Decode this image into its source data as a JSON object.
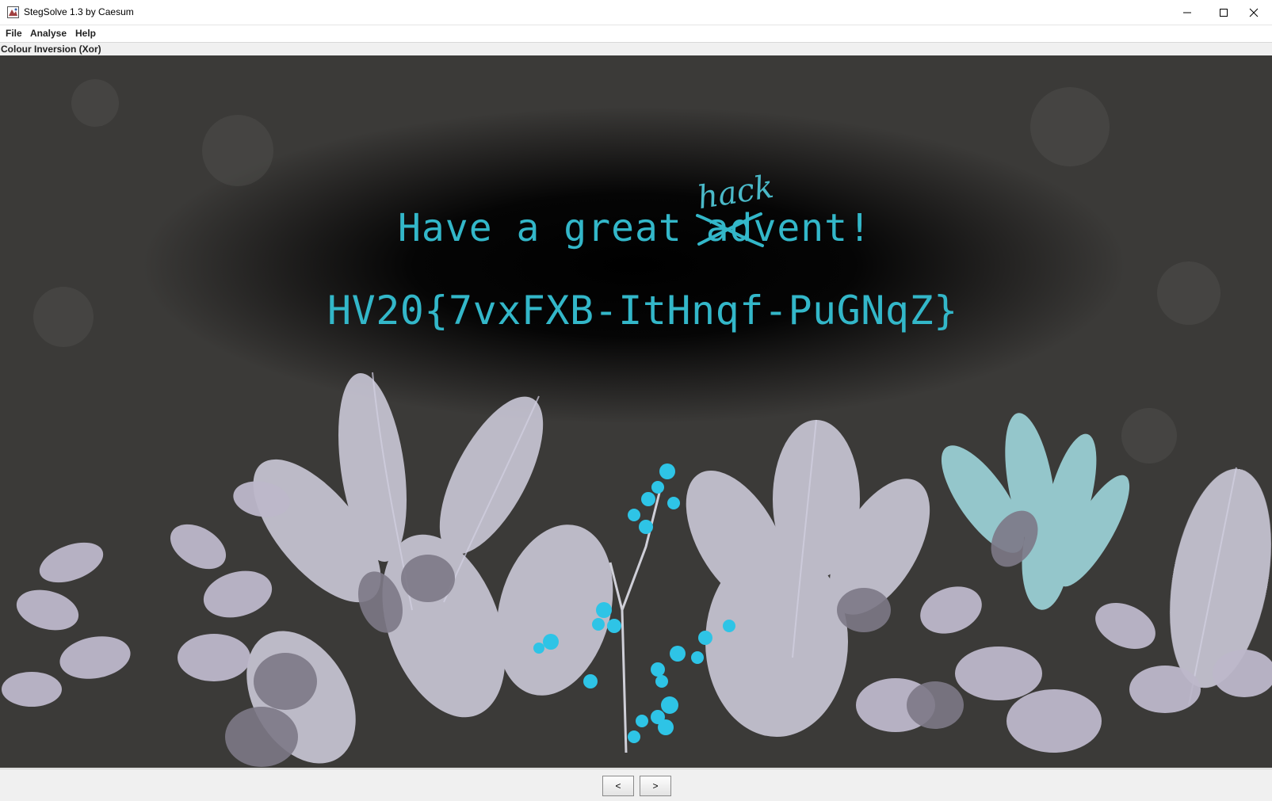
{
  "window": {
    "title": "StegSolve 1.3 by Caesum",
    "icons": {
      "app": "stegsolve-app-icon",
      "minimize": "minimize-icon",
      "maximize": "maximize-icon",
      "close": "close-icon"
    }
  },
  "menu": {
    "file": "File",
    "analyse": "Analyse",
    "help": "Help"
  },
  "view": {
    "label": "Colour Inversion (Xor)"
  },
  "image": {
    "greeting": "Have a great advent!",
    "greeting_parts": {
      "prefix": "Have a great ",
      "struck": "ad",
      "suffix": "vent!"
    },
    "annotation": "hack",
    "flag": "HV20{7vxFXB-ItHnqf-PuGNqZ}",
    "colors": {
      "text": "#33b7c9",
      "background": "#3b3a38",
      "plants": "#d8d6e4",
      "berries": "#2ec4e6"
    }
  },
  "navigation": {
    "prev": "<",
    "next": ">"
  }
}
